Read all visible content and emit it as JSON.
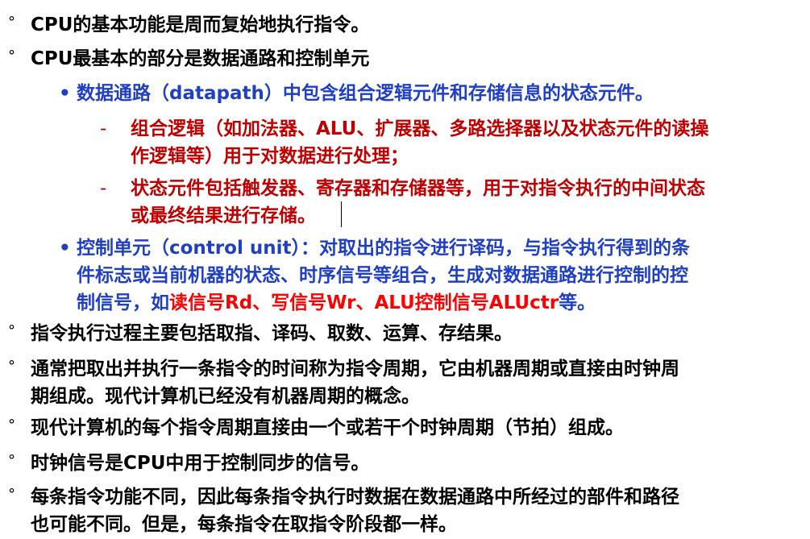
{
  "bullet_marker": "°",
  "sub_marker": "•",
  "dash_marker": "-",
  "items": [
    {
      "lines": [
        "CPU的基本功能是周而复始地执行指令。"
      ]
    },
    {
      "lines": [
        "CPU最基本的部分是数据通路和控制单元"
      ]
    },
    {
      "lines": [
        "数据通路（datapath）中包含组合逻辑元件和存储信息的状态元件。"
      ]
    },
    {
      "lines": [
        "组合逻辑（如加法器、ALU、扩展器、多路选择器以及状态元件的读操",
        "作逻辑等）用于对数据进行处理；"
      ]
    },
    {
      "lines": [
        "状态元件包括触发器、寄存器和存储器等，用于对指令执行的中间状态",
        "或最终结果进行存储。"
      ]
    },
    {
      "lines": [
        "控制单元（control unit）：对取出的指令进行译码，与指令执行得到的条",
        "件标志或当前机器的状态、时序信号等组合，生成对数据通路进行控制的控"
      ],
      "last_prefix": "制信号，如",
      "last_highlight": "读信号Rd、写信号Wr、ALU控制信号ALUctr",
      "last_suffix": "等。"
    },
    {
      "lines": [
        "指令执行过程主要包括取指、译码、取数、运算、存结果。"
      ]
    },
    {
      "lines": [
        "通常把取出并执行一条指令的时间称为指令周期，它由机器周期或直接由时钟周",
        "期组成。现代计算机已经没有机器周期的概念。"
      ]
    },
    {
      "lines": [
        "现代计算机的每个指令周期直接由一个或若干个时钟周期（节拍）组成。"
      ]
    },
    {
      "lines": [
        "时钟信号是CPU中用于控制同步的信号。"
      ]
    },
    {
      "lines": [
        "每条指令功能不同，因此每条指令执行时数据在数据通路中所经过的部件和路径",
        "也可能不同。但是，每条指令在取指令阶段都一样。"
      ]
    }
  ],
  "colors": {
    "level1": "#000000",
    "level2": "#1f3fc4",
    "level3": "#c00000",
    "highlight": "#ff0000"
  }
}
